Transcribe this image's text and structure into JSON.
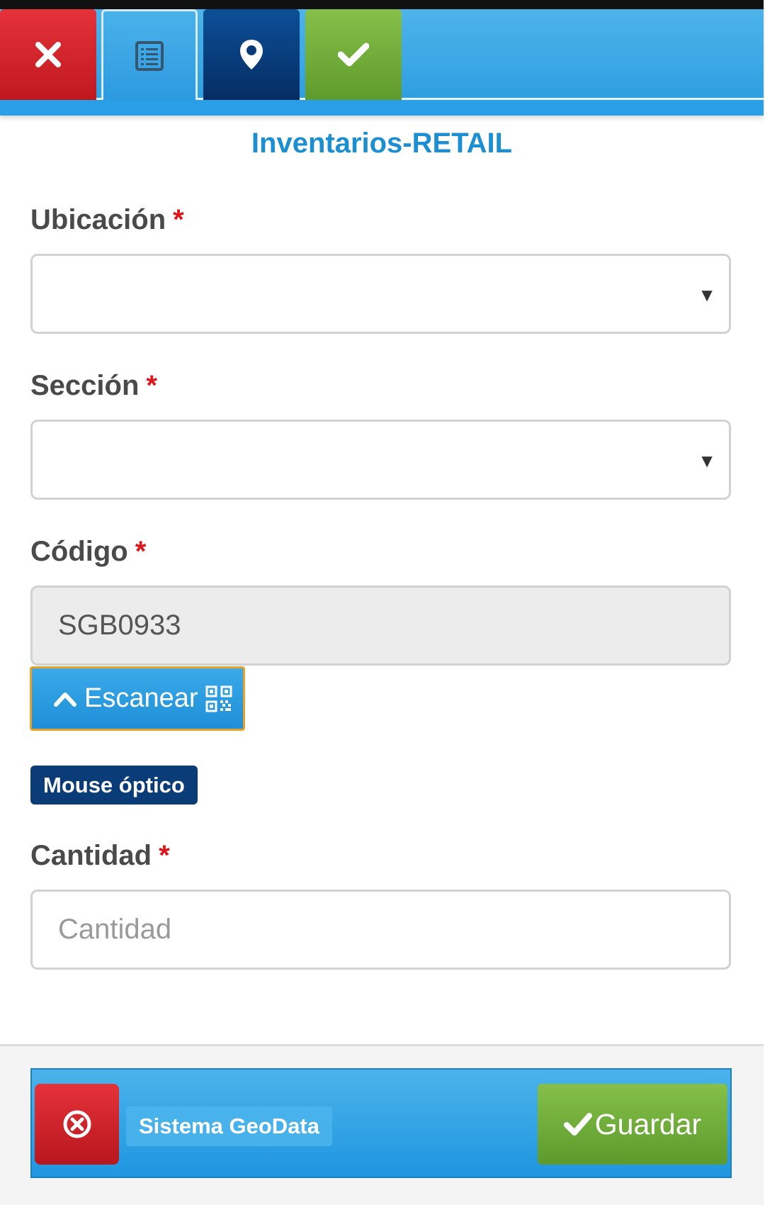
{
  "toolbar": {
    "close_icon": "close-icon",
    "list_icon": "list-icon",
    "map_icon": "map-marker-icon",
    "check_icon": "check-icon"
  },
  "page_title": "Inventarios-RETAIL",
  "form": {
    "ubicacion": {
      "label": "Ubicación",
      "required_mark": "*",
      "value": ""
    },
    "seccion": {
      "label": "Sección",
      "required_mark": "*",
      "value": ""
    },
    "codigo": {
      "label": "Código",
      "required_mark": "*",
      "value": "SGB0933"
    },
    "scan_button": {
      "label": "Escanear"
    },
    "mouse_badge": "Mouse óptico",
    "cantidad": {
      "label": "Cantidad",
      "required_mark": "*",
      "placeholder": "Cantidad"
    }
  },
  "footer": {
    "brand": "Sistema GeoData",
    "save_label": "Guardar"
  },
  "colors": {
    "primary_blue": "#2f9fe1",
    "navy": "#0a3d78",
    "danger_red": "#c0181f",
    "success_green": "#6aab34",
    "title_blue": "#1b8fd2"
  }
}
